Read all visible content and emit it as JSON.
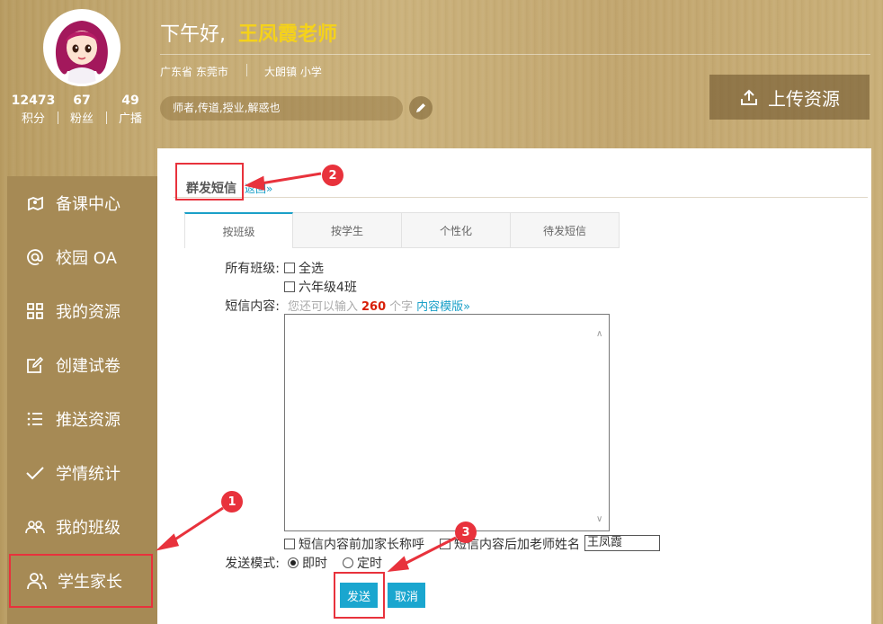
{
  "profile": {
    "stats": [
      {
        "value": "12473",
        "label": "积分"
      },
      {
        "value": "67",
        "label": "粉丝"
      },
      {
        "value": "49",
        "label": "广播"
      }
    ]
  },
  "header": {
    "greeting": "下午好,",
    "teacher_name": "王凤霞老师",
    "location": "广东省 东莞市",
    "school": "大朗镇      小学",
    "motto": "师者,传道,授业,解惑也",
    "upload_label": "上传资源"
  },
  "sidebar": {
    "items": [
      {
        "label": "备课中心",
        "icon": "map-pin-icon"
      },
      {
        "label": "校园 OA",
        "icon": "at-icon"
      },
      {
        "label": "我的资源",
        "icon": "grid-icon"
      },
      {
        "label": "创建试卷",
        "icon": "edit-icon"
      },
      {
        "label": "推送资源",
        "icon": "list-icon"
      },
      {
        "label": "学情统计",
        "icon": "check-icon"
      },
      {
        "label": "我的班级",
        "icon": "group-icon"
      },
      {
        "label": "学生家长",
        "icon": "users-icon"
      }
    ]
  },
  "main": {
    "title": "群发短信",
    "back_link": "返回»",
    "tabs": [
      {
        "label": "按班级"
      },
      {
        "label": "按学生"
      },
      {
        "label": "个性化"
      },
      {
        "label": "待发短信"
      }
    ],
    "class_label": "所有班级:",
    "select_all": "全选",
    "class_option": "六年级4班",
    "content_label": "短信内容:",
    "hint_prefix": "您还可以输入",
    "hint_count": "260",
    "hint_suffix": "个字",
    "template_link": "内容模版»",
    "prefix_parent_option": "短信内容前加家长称呼",
    "suffix_teacher_option": "短信内容后加老师姓名",
    "teacher_name_value": "王凤霞",
    "mode_label": "发送模式:",
    "mode_instant": "即时",
    "mode_scheduled": "定时",
    "send_label": "发送",
    "cancel_label": "取消"
  },
  "annotations": {
    "markers": [
      "1",
      "2",
      "3"
    ],
    "color": "#e8323c"
  }
}
